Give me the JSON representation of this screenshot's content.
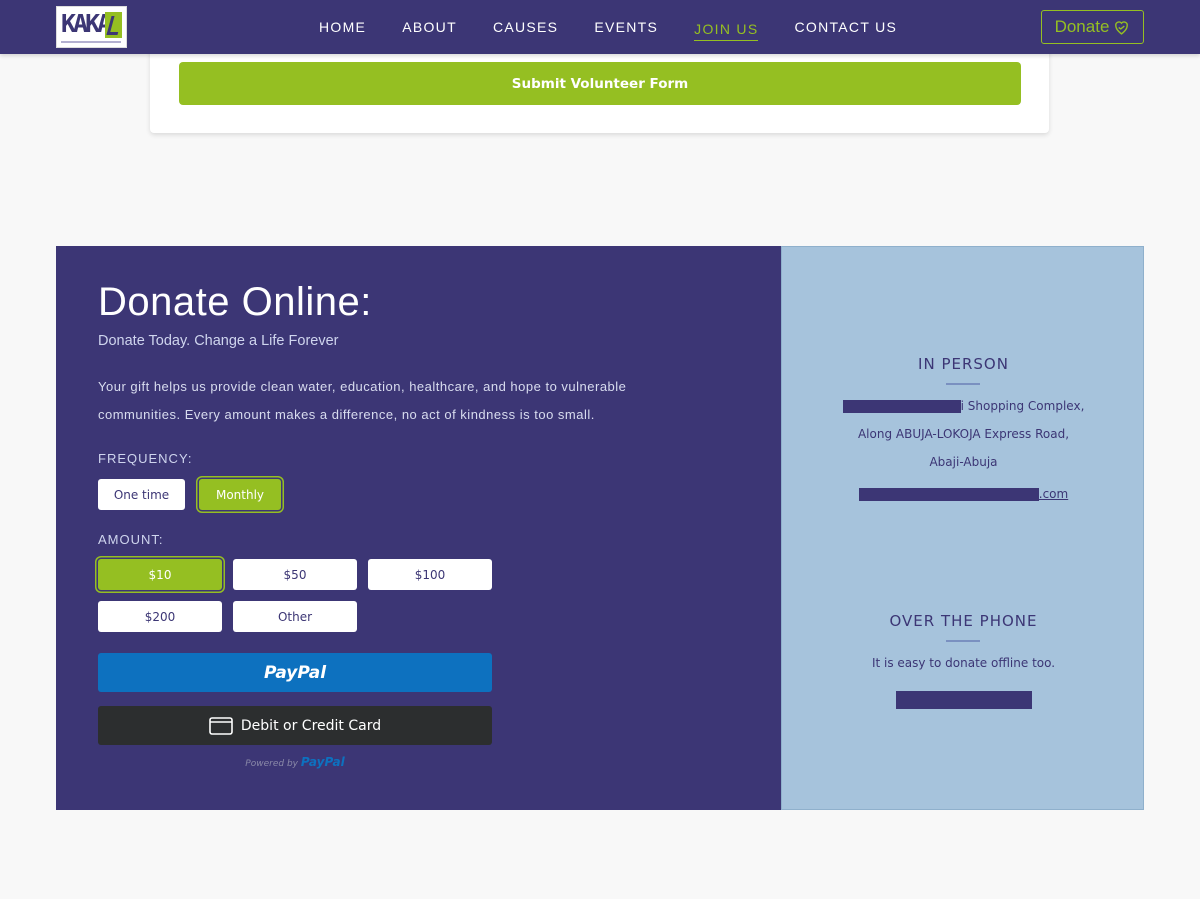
{
  "nav": {
    "logo_text": "KAKA",
    "items": [
      {
        "label": "HOME",
        "active": false
      },
      {
        "label": "ABOUT",
        "active": false
      },
      {
        "label": "CAUSES",
        "active": false
      },
      {
        "label": "EVENTS",
        "active": false
      },
      {
        "label": "JOIN US",
        "active": true
      },
      {
        "label": "CONTACT US",
        "active": false
      }
    ],
    "donate_label": "Donate",
    "donate_icon": "heart-hand-icon"
  },
  "form": {
    "submit_label": "Submit Volunteer Form"
  },
  "donate": {
    "title": "Donate Online:",
    "subtitle": "Donate Today. Change a Life Forever",
    "description": "Your gift helps us provide clean water, education, healthcare, and hope to vulnerable communities. Every amount makes a difference, no act of kindness is too small.",
    "frequency_label": "FREQUENCY:",
    "frequency_options": [
      "One time",
      "Monthly"
    ],
    "frequency_selected": "Monthly",
    "amount_label": "AMOUNT:",
    "amount_options": [
      "$10",
      "$50",
      "$100",
      "$200",
      "Other"
    ],
    "amount_selected": "$10",
    "paypal_label": "PayPal",
    "card_label": "Debit or Credit Card",
    "powered_by": "Powered by",
    "powered_brand": "PayPal"
  },
  "contact": {
    "in_person_title": "IN PERSON",
    "address_line1_suffix": "i Shopping Complex,",
    "address_line2": "Along ABUJA-LOKOJA Express Road,",
    "address_line3": "Abaji-Abuja",
    "email_suffix": ".com",
    "phone_title": "OVER THE PHONE",
    "phone_text": "It is easy to donate offline too."
  },
  "colors": {
    "primary": "#3c3675",
    "accent": "#95bf22",
    "panel": "#a6c3dc",
    "paypal": "#0d71bf",
    "card": "#2c2e2f"
  }
}
